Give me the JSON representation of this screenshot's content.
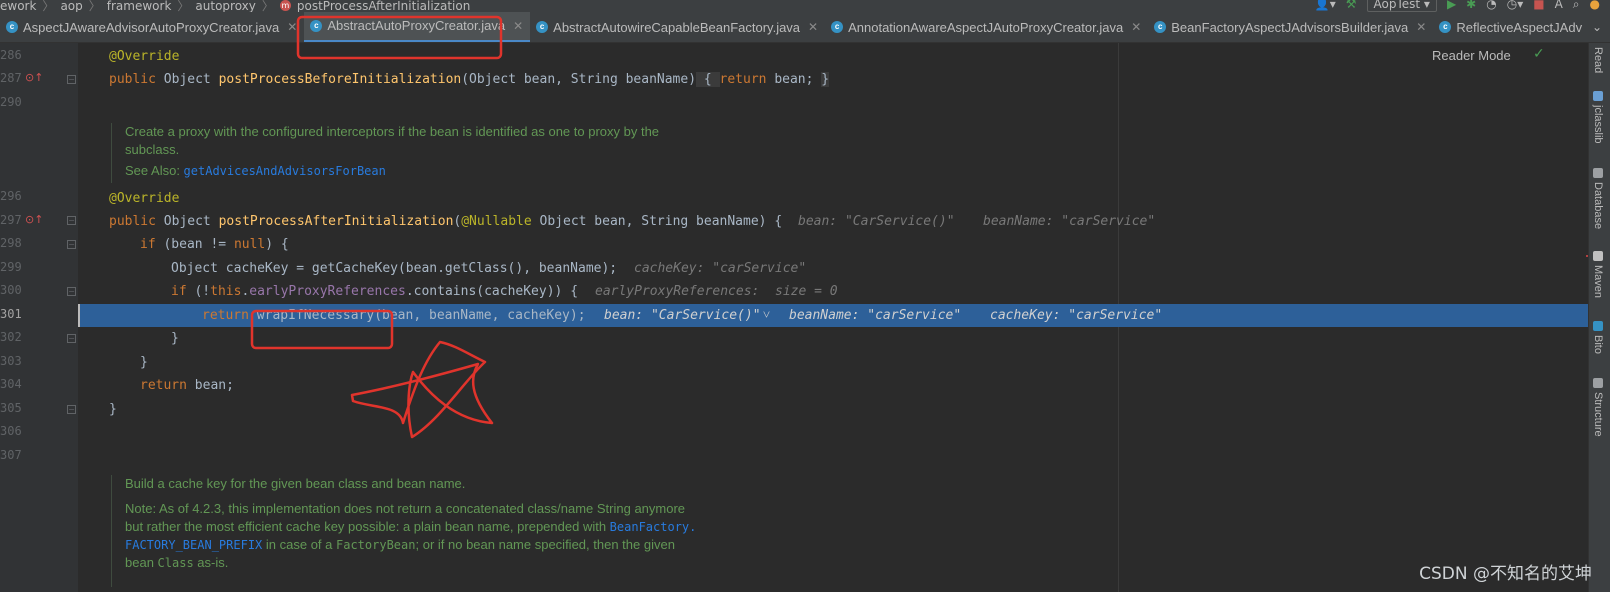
{
  "breadcrumb": [
    "ework",
    "aop",
    "framework",
    "autoproxy",
    "postProcessAfterInitialization"
  ],
  "method_icon": "m",
  "run_config": "AopTest",
  "tabs": [
    {
      "label": "AspectJAwareAdvisorAutoProxyCreator.java",
      "active": false
    },
    {
      "label": "AbstractAutoProxyCreator.java",
      "active": true
    },
    {
      "label": "AbstractAutowireCapableBeanFactory.java",
      "active": false
    },
    {
      "label": "AnnotationAwareAspectJAutoProxyCreator.java",
      "active": false
    },
    {
      "label": "BeanFactoryAspectJAdvisorsBuilder.java",
      "active": false
    },
    {
      "label": "ReflectiveAspectJAdv",
      "active": false
    }
  ],
  "line_numbers": [
    "286",
    "287",
    "290",
    "",
    "",
    "",
    "296",
    "297",
    "298",
    "299",
    "300",
    "301",
    "302",
    "303",
    "304",
    "305",
    "306",
    "307"
  ],
  "reader_mode": "Reader Mode",
  "code": {
    "l286_ann": "@Override",
    "l287_kw": "public",
    "l287_type": " Object ",
    "l287_fn": "postProcessBeforeInitialization",
    "l287_args": "(Object bean, String beanName)",
    "l287_fold": " { ",
    "l287_ret": "return",
    "l287_tail": " bean; ",
    "l287_end": "}",
    "doc1_line1": "Create a proxy with the configured interceptors if the bean is identified as one to proxy by the",
    "doc1_line2": "subclass.",
    "doc1_see": "See Also: ",
    "doc1_ref": "getAdvicesAndAdvisorsForBean",
    "l296_ann": "@Override",
    "l297_kw": "public",
    "l297_a": " Object ",
    "l297_fn": "postProcessAfterInitialization",
    "l297_b": "(",
    "l297_ann": "@Nullable",
    "l297_c": " Object bean, String beanName) {",
    "l297_hint1": "bean: \"CarService()\"",
    "l297_hint2": "beanName: \"carService\"",
    "l298_kw": "if",
    "l298_a": " (bean != ",
    "l298_null": "null",
    "l298_b": ") {",
    "l299": "Object cacheKey = getCacheKey(bean.getClass(), beanName);",
    "l299_hint": "cacheKey: \"carService\"",
    "l300_kw": "if",
    "l300_a": " (!",
    "l300_this": "this",
    "l300_dot": ".",
    "l300_fld": "earlyProxyReferences",
    "l300_b": ".contains(cacheKey)) {",
    "l300_hint": "earlyProxyReferences:  size = 0",
    "l301_kw": "return",
    "l301_call": "wrapIfNecessary",
    "l301_args": "(bean, beanName, cacheKey);",
    "l301_hint1": "bean: \"CarService()\"",
    "l301_hint2": "beanName: \"carService\"",
    "l301_hint3": "cacheKey: \"carService\"",
    "l302": "}",
    "l303": "}",
    "l304_kw": "return",
    "l304_a": " bean;",
    "l305": "}",
    "doc2_line1": "Build a cache key for the given bean class and bean name.",
    "doc2_note1": "Note: As of 4.2.3, this implementation does not return a concatenated class/name String anymore",
    "doc2_note2": "but rather the most efficient cache key possible: a plain bean name, prepended with ",
    "doc2_ref1": "BeanFactory.",
    "doc2_ref2": "FACTORY_BEAN_PREFIX",
    "doc2_note3": " in case of a ",
    "doc2_code1": "FactoryBean",
    "doc2_note4": "; or if no bean name specified, then the given",
    "doc2_note5": "bean ",
    "doc2_code2": "Class",
    "doc2_note6": " as-is."
  },
  "right_tools": [
    "Read",
    "jclasslib",
    "Database",
    "Maven",
    "Bito",
    "Structure"
  ],
  "watermark": "CSDN @不知名的艾坤",
  "colors": {
    "accent": "#4a88c7",
    "exec_line": "#2d6099",
    "markup_red": "#e0342c"
  }
}
